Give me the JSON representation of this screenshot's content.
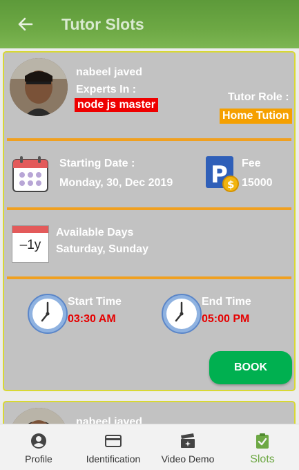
{
  "appbar": {
    "title": "Tutor Slots"
  },
  "slot": {
    "tutor_name": "nabeel javed",
    "experts_label": "Experts In :",
    "expertise": "node js master",
    "role_label": "Tutor Role :",
    "role": "Home Tution",
    "start_date_label": "Starting Date :",
    "start_date": "Monday, 30, Dec 2019",
    "fee_label": "Fee",
    "fee": "15000",
    "available_days_label": "Available Days",
    "available_days": "Saturday, Sunday",
    "calendar_icon_text": "–1y",
    "start_time_label": "Start Time",
    "start_time": "03:30 AM",
    "end_time_label": "End Time",
    "end_time": "05:00 PM",
    "book_label": "BOOK"
  },
  "slot2": {
    "tutor_name": "nabeel javed"
  },
  "nav": [
    {
      "label": "Profile",
      "icon": "account-circle-icon"
    },
    {
      "label": "Identification",
      "icon": "id-card-icon"
    },
    {
      "label": "Video Demo",
      "icon": "video-clapper-icon"
    },
    {
      "label": "Slots",
      "icon": "clipboard-check-icon",
      "active": true
    }
  ],
  "colors": {
    "appbar": "#6da844",
    "separator": "#f0a020",
    "expertise_bg": "#ee0000",
    "role_bg": "#f5a000",
    "time_text": "#e60000",
    "book_button": "#00b050",
    "active_tab": "#6da844"
  }
}
